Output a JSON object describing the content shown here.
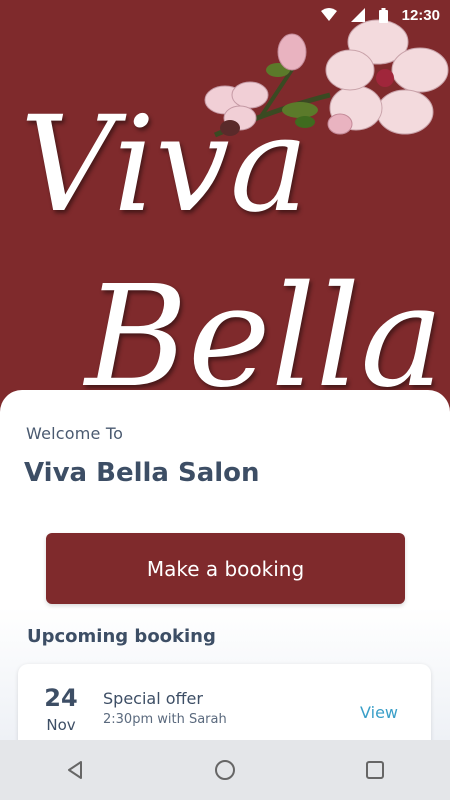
{
  "status": {
    "time": "12:30",
    "icons": [
      "wifi-icon",
      "signal-icon",
      "battery-icon"
    ]
  },
  "hero": {
    "logo_line1": "Viva",
    "logo_line2": "Bella"
  },
  "welcome": {
    "intro": "Welcome To",
    "salon_name": "Viva Bella Salon"
  },
  "booking_button": {
    "label": "Make a booking"
  },
  "upcoming": {
    "title": "Upcoming booking",
    "item": {
      "day": "24",
      "month": "Nov",
      "title": "Special offer",
      "detail": "2:30pm with Sarah",
      "action": "View"
    }
  },
  "navigation": {
    "buttons": [
      "back-icon",
      "home-icon",
      "recents-icon"
    ]
  },
  "colors": {
    "brand": "#7f2a2c",
    "text": "#3d4e65",
    "link": "#3a9fc8"
  }
}
